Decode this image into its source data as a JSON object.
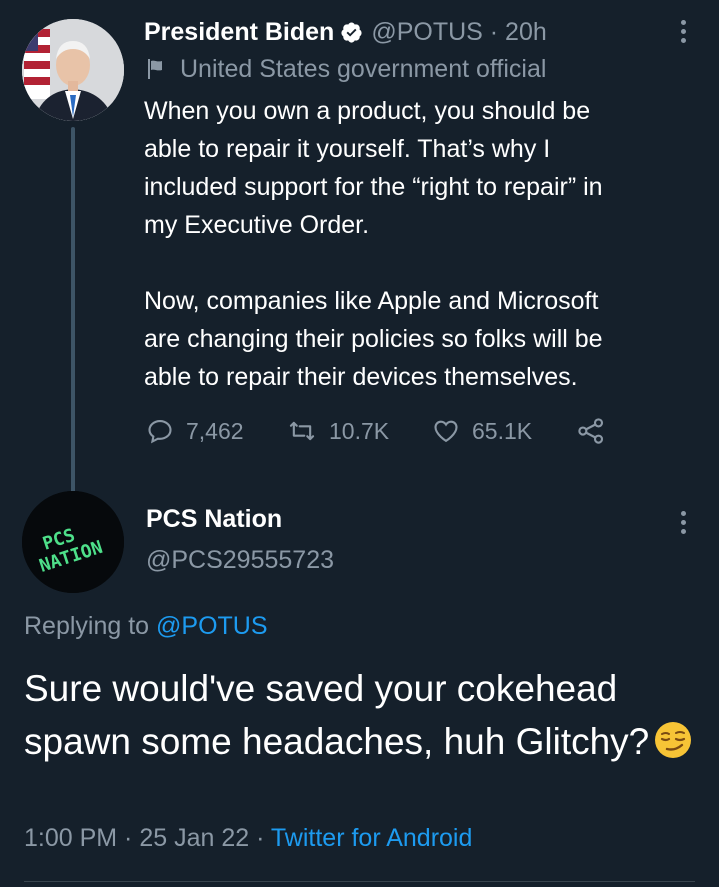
{
  "colors": {
    "background": "#15202b",
    "primary_text": "#ffffff",
    "secondary_text": "#8b98a5",
    "accent": "#1d9bf0",
    "thread_line": "#3d5466",
    "logo_green": "#4ee08a"
  },
  "parent_tweet": {
    "display_name": "President Biden",
    "verified_icon": "verified-badge-icon",
    "handle": "@POTUS",
    "separator": "·",
    "time": "20h",
    "handle_time": "@POTUS · 20h",
    "label_icon": "flag-icon",
    "label": "United States government official",
    "text_paragraph_1": "When you own a product, you should be\nable to repair it yourself. That’s why I\nincluded support for the “right to repair” in\nmy Executive Order.",
    "text_paragraph_2": "Now, companies like Apple and Microsoft\nare changing their policies so folks will be\nable to repair their devices themselves.",
    "reply_count": "7,462",
    "retweet_count": "10.7K",
    "like_count": "65.1K",
    "icons": [
      "reply-icon",
      "retweet-icon",
      "like-icon",
      "share-icon",
      "more-icon"
    ]
  },
  "reply_tweet": {
    "display_name": "PCS Nation",
    "handle": "@PCS29555723",
    "avatar_logo_text": "PCS NATION",
    "replying_prefix": "Replying to",
    "replying_to": "@POTUS",
    "text": "Sure would've saved your cokehead spawn some headaches, huh Glitchy?",
    "emoji": "smirking-face-emoji",
    "timestamp": "1:00 PM · 25 Jan 22 · ",
    "source": "Twitter for Android"
  }
}
